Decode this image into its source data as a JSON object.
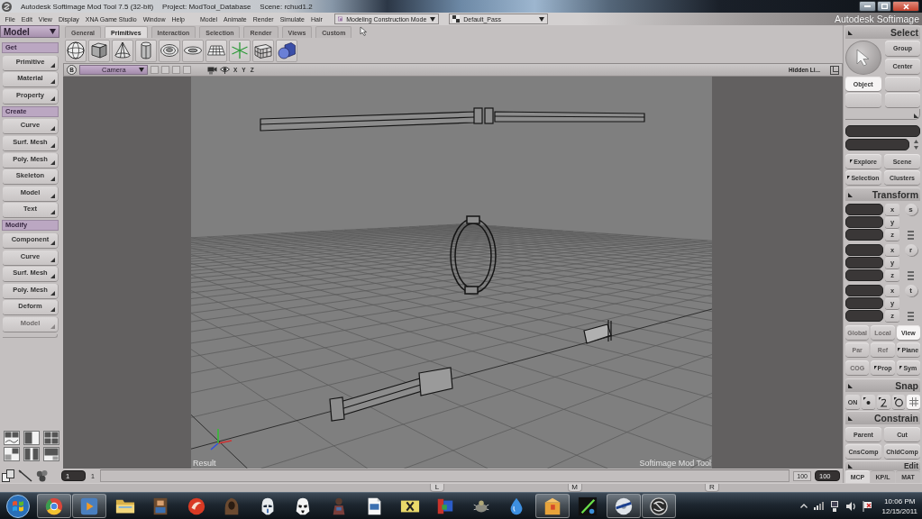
{
  "window": {
    "title": "Autodesk Softimage Mod Tool 7.5 (32-bit)",
    "project": "Project: ModTool_Database",
    "scene": "Scene: rchud1.2"
  },
  "menu_bar": {
    "menus": [
      "File",
      "Edit",
      "View",
      "Display",
      "XNA Game Studio",
      "Window",
      "Help"
    ],
    "modules": [
      "Model",
      "Animate",
      "Render",
      "Simulate",
      "Hair"
    ],
    "construction_mode": "Modeling Construction Mode",
    "render_pass": "Default_Pass",
    "brand": "Autodesk Softimage"
  },
  "toolbar": {
    "module": "Model",
    "tabs": [
      {
        "label": "General",
        "selected": false
      },
      {
        "label": "Primitives",
        "selected": true
      },
      {
        "label": "Interaction",
        "selected": false
      },
      {
        "label": "Selection",
        "selected": false
      },
      {
        "label": "Render",
        "selected": false
      },
      {
        "label": "Views",
        "selected": false
      },
      {
        "label": "Custom",
        "selected": false
      }
    ],
    "tools": [
      {
        "kind": "sphere"
      },
      {
        "kind": "cube"
      },
      {
        "kind": "cone"
      },
      {
        "kind": "cylinder"
      },
      {
        "kind": "torus"
      },
      {
        "kind": "disc"
      },
      {
        "kind": "grid"
      },
      {
        "kind": "null"
      },
      {
        "kind": "lattice"
      },
      {
        "kind": "model"
      }
    ]
  },
  "left_panel": {
    "sections": [
      {
        "title": "Get",
        "buttons": [
          {
            "label": "Primitive",
            "disabled": false
          },
          {
            "label": "Material",
            "disabled": false
          },
          {
            "label": "Property",
            "disabled": false
          }
        ]
      },
      {
        "title": "Create",
        "buttons": [
          {
            "label": "Curve",
            "disabled": false
          },
          {
            "label": "Surf. Mesh",
            "disabled": false
          },
          {
            "label": "Poly. Mesh",
            "disabled": false
          },
          {
            "label": "Skeleton",
            "disabled": false
          },
          {
            "label": "Model",
            "disabled": false
          },
          {
            "label": "Text",
            "disabled": false
          }
        ]
      },
      {
        "title": "Modify",
        "buttons": [
          {
            "label": "Component",
            "disabled": false
          },
          {
            "label": "Curve",
            "disabled": false
          },
          {
            "label": "Surf. Mesh",
            "disabled": false
          },
          {
            "label": "Poly. Mesh",
            "disabled": false
          },
          {
            "label": "Deform",
            "disabled": false
          },
          {
            "label": "Model",
            "disabled": true
          }
        ]
      }
    ]
  },
  "viewport": {
    "badge": "B",
    "view": "Camera",
    "axes": [
      "X",
      "Y",
      "Z"
    ],
    "display_mode": "Hidden Li...",
    "pass_label": "Result",
    "product_label": "Softimage Mod Tool"
  },
  "timeline": {
    "start_field": "1",
    "start": "1",
    "end": "100",
    "end_field": "100",
    "markers": [
      "L",
      "M",
      "R"
    ]
  },
  "right_panel": {
    "select": {
      "title": "Select",
      "buttons": [
        "Group",
        "Center"
      ],
      "modes": [
        {
          "label": "Object",
          "selected": true
        }
      ]
    },
    "explorer": [
      {
        "label": "Explore",
        "options_mark": true
      },
      {
        "label": "Scene",
        "options_mark": false
      },
      {
        "label": "Selection",
        "options_mark": true
      },
      {
        "label": "Clusters",
        "options_mark": false
      }
    ],
    "transform": {
      "title": "Transform",
      "groups": [
        {
          "letter": "s",
          "axes": [
            "x",
            "y",
            "z"
          ]
        },
        {
          "letter": "r",
          "axes": [
            "x",
            "y",
            "z"
          ]
        },
        {
          "letter": "t",
          "axes": [
            "x",
            "y",
            "z"
          ]
        }
      ],
      "reference": [
        {
          "label": "Global",
          "disabled": true,
          "selected": false
        },
        {
          "label": "Local",
          "disabled": true,
          "selected": false
        },
        {
          "label": "View",
          "disabled": false,
          "selected": true
        }
      ],
      "pivot": [
        {
          "label": "Par",
          "disabled": true,
          "options_mark": false
        },
        {
          "label": "Ref",
          "disabled": true,
          "options_mark": false
        },
        {
          "label": "Plane",
          "disabled": false,
          "options_mark": true
        }
      ],
      "options": [
        {
          "label": "COG",
          "disabled": true,
          "options_mark": false
        },
        {
          "label": "Prop",
          "disabled": false,
          "options_mark": true
        },
        {
          "label": "Sym",
          "disabled": false,
          "options_mark": true
        }
      ]
    },
    "snap": {
      "title": "Snap",
      "toggle": {
        "label": "ON",
        "selected": false
      },
      "tools": [
        {
          "kind": "point",
          "selected": false
        },
        {
          "kind": "curve",
          "selected": false
        },
        {
          "kind": "ring",
          "selected": false
        },
        {
          "kind": "grid",
          "selected": true
        }
      ]
    },
    "constrain": {
      "title": "Constrain",
      "buttons": [
        "Parent",
        "Cut",
        "CnsComp",
        "ChldComp"
      ]
    },
    "edit": {
      "title": "Edit"
    },
    "tabs": [
      {
        "label": "MCP",
        "selected": true
      },
      {
        "label": "KP/L",
        "selected": false
      },
      {
        "label": "MAT",
        "selected": false
      }
    ]
  },
  "taskbar": {
    "items": [
      {
        "kind": "browser",
        "open": true
      },
      {
        "kind": "player",
        "open": true
      },
      {
        "kind": "folder",
        "open": false
      },
      {
        "kind": "pixel",
        "open": false
      },
      {
        "kind": "swirl",
        "open": false
      },
      {
        "kind": "hood",
        "open": false
      },
      {
        "kind": "helmet",
        "open": false
      },
      {
        "kind": "trooper",
        "open": false
      },
      {
        "kind": "figure",
        "open": false
      },
      {
        "kind": "document",
        "open": false
      },
      {
        "kind": "cross",
        "open": false
      },
      {
        "kind": "blocks",
        "open": false
      },
      {
        "kind": "bug",
        "open": false
      },
      {
        "kind": "drop",
        "open": false
      },
      {
        "kind": "box",
        "open": true
      },
      {
        "kind": "beam",
        "open": false
      },
      {
        "kind": "disc",
        "open": true
      },
      {
        "kind": "logo",
        "open": true
      }
    ],
    "time": "10:06 PM",
    "date": "12/15/2011"
  }
}
